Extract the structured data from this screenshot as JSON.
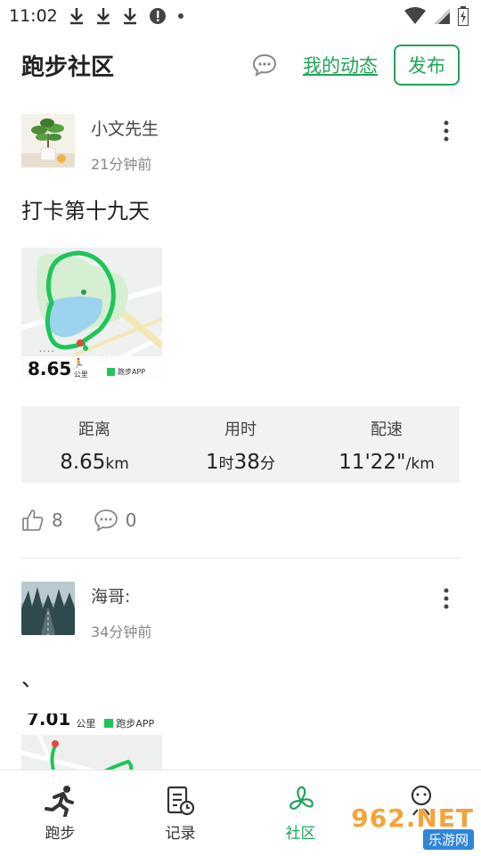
{
  "status": {
    "time": "11:02"
  },
  "header": {
    "title": "跑步社区",
    "my_dynamics": "我的动态",
    "publish": "发布"
  },
  "posts": [
    {
      "user": "小文先生",
      "time": "21分钟前",
      "content": "打卡第十九天",
      "map": {
        "distance": "8.65",
        "unit": "公里",
        "brand": "跑步APP"
      },
      "stats": {
        "distance_label": "距离",
        "distance_value": "8.65",
        "distance_unit": "km",
        "time_label": "用时",
        "time_hours": "1",
        "time_hours_unit": "时",
        "time_minutes": "38",
        "time_minutes_unit": "分",
        "pace_label": "配速",
        "pace_value": "11'22\"",
        "pace_unit": "/km"
      },
      "likes": "8",
      "comments": "0"
    },
    {
      "user": "海哥:",
      "time": "34分钟前",
      "content": "、",
      "map": {
        "distance": "7.01",
        "unit": "公里",
        "brand": "跑步APP"
      }
    }
  ],
  "nav": {
    "run": "跑步",
    "record": "记录",
    "community": "社区",
    "active": "community"
  },
  "watermark": {
    "top": "962.NET",
    "bottom": "乐游网"
  },
  "colors": {
    "accent": "#21a35a",
    "route": "#1fc45a",
    "stats_bg": "#f2f2f2"
  }
}
